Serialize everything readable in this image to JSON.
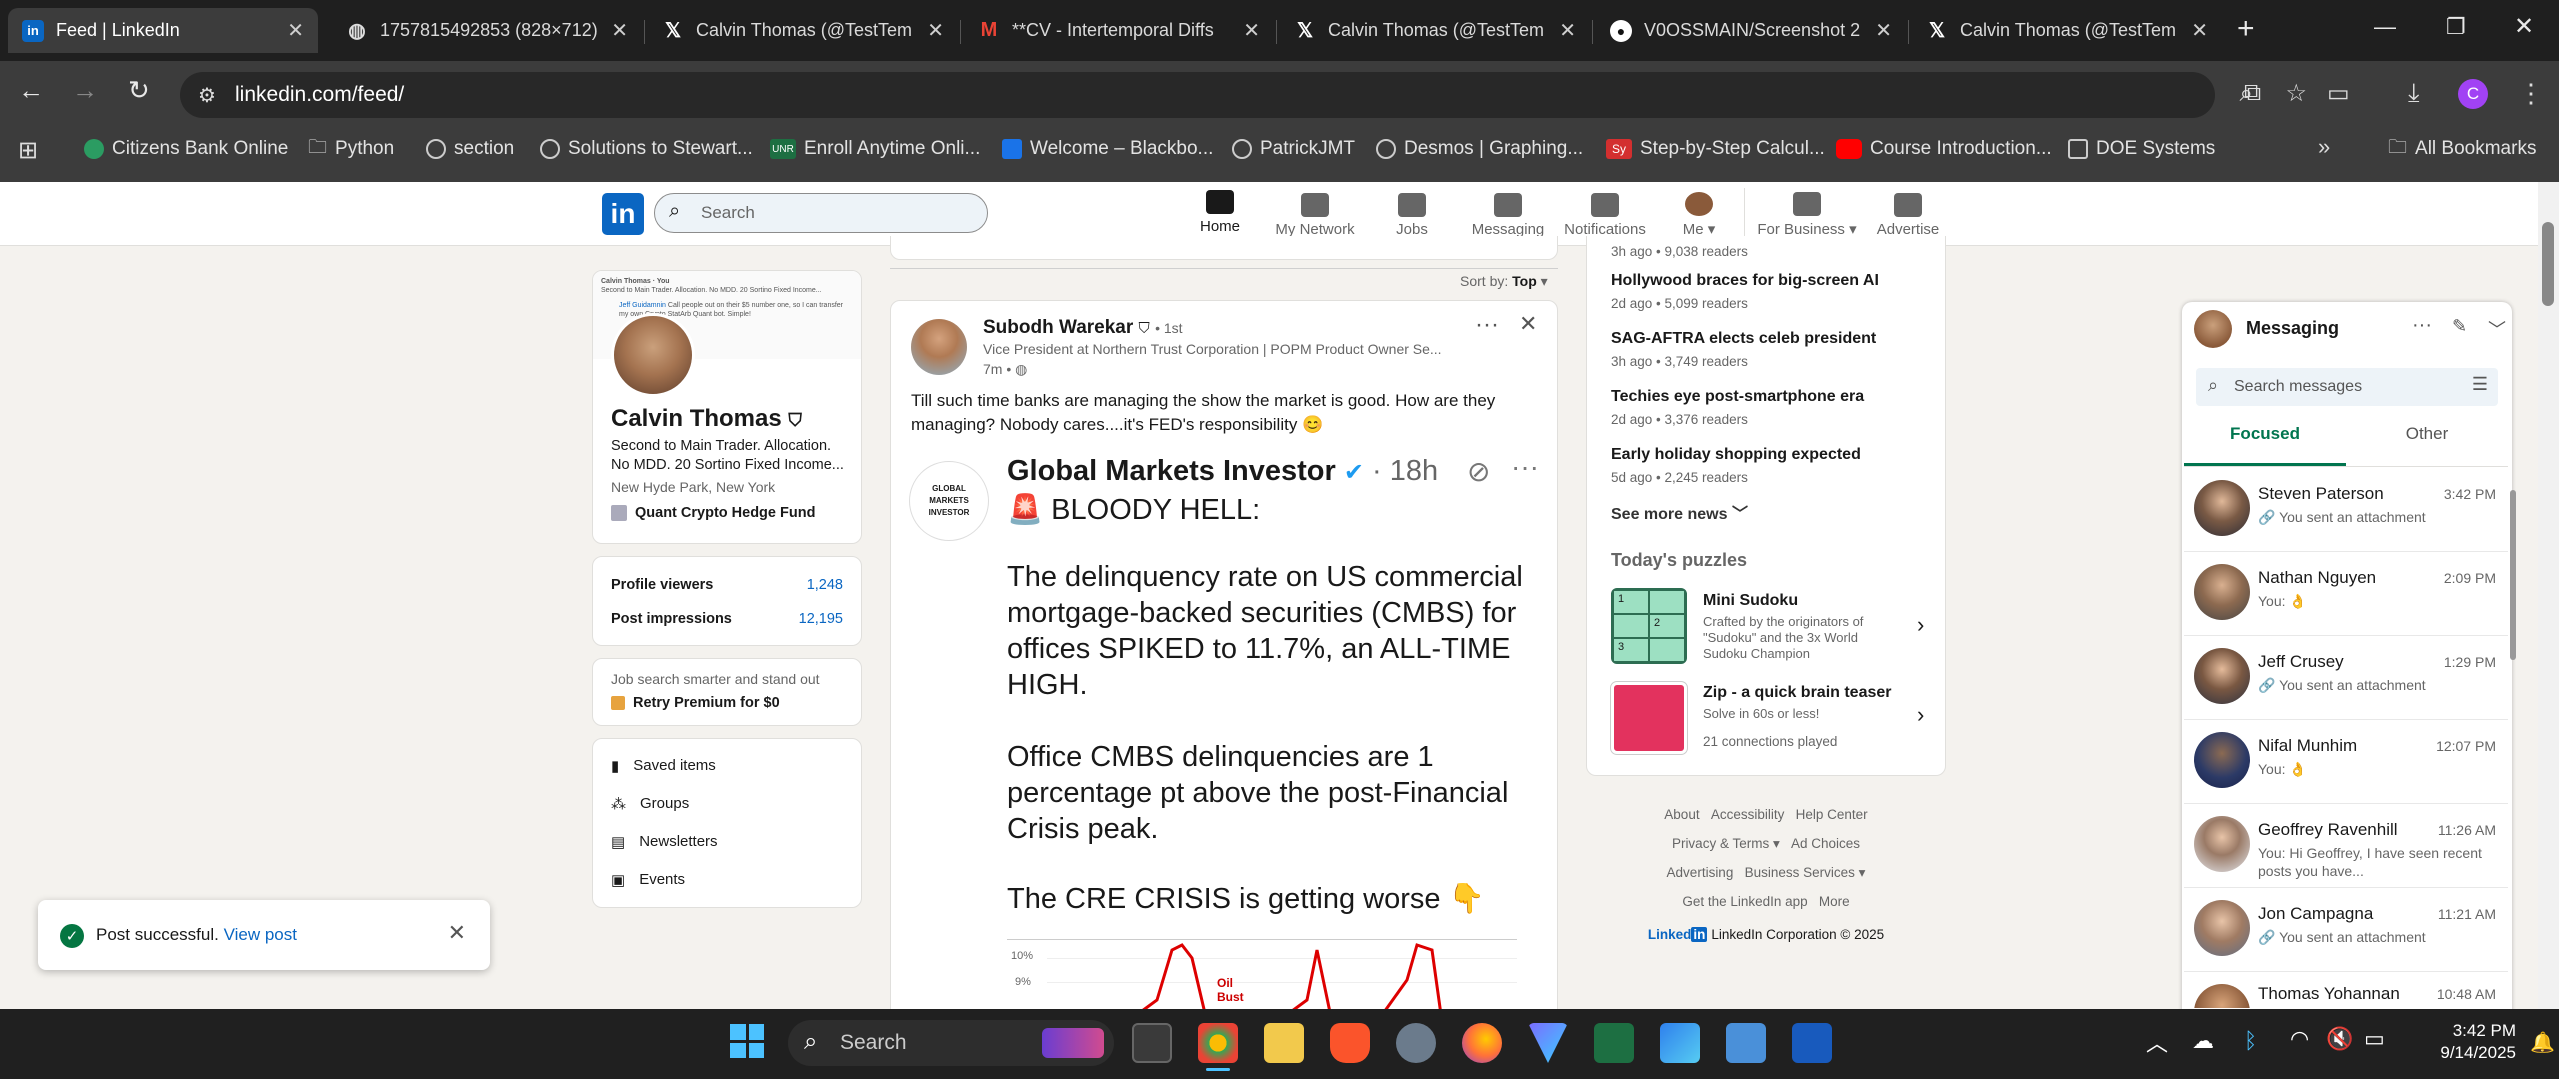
{
  "browser": {
    "tabs": [
      {
        "title": "Feed | LinkedIn",
        "icon": "linkedin-icon",
        "active": true
      },
      {
        "title": "1757815492853 (828×712)",
        "icon": "globe-icon"
      },
      {
        "title": "Calvin Thomas (@TestTem",
        "icon": "x-icon"
      },
      {
        "title": "**CV - Intertemporal Diffs",
        "icon": "gmail-icon"
      },
      {
        "title": "Calvin Thomas (@TestTem",
        "icon": "x-icon"
      },
      {
        "title": "V0OSSMAIN/Screenshot 2",
        "icon": "github-icon"
      },
      {
        "title": "Calvin Thomas (@TestTem",
        "icon": "x-icon"
      }
    ],
    "url": "linkedin.com/feed/",
    "profile_letter": "C",
    "bookmarks": [
      "Citizens Bank Online",
      "Python",
      "section",
      "Solutions to Stewart...",
      "Enroll Anytime Onli...",
      "Welcome – Blackbo...",
      "PatrickJMT",
      "Desmos | Graphing...",
      "Step-by-Step Calcul...",
      "Course Introduction...",
      "DOE Systems"
    ],
    "all_bookmarks": "All Bookmarks",
    "bookmark_badge_unr": "UNR",
    "bookmark_badge_sy": "Sy"
  },
  "linkedin": {
    "logo": "in",
    "search_placeholder": "Search",
    "nav": [
      {
        "label": "Home",
        "icon": "home-icon"
      },
      {
        "label": "My Network",
        "icon": "network-icon"
      },
      {
        "label": "Jobs",
        "icon": "briefcase-icon"
      },
      {
        "label": "Messaging",
        "icon": "chat-icon"
      },
      {
        "label": "Notifications",
        "icon": "bell-icon"
      },
      {
        "label": "Me",
        "icon": "avatar-icon"
      },
      {
        "label": "For Business",
        "icon": "grid-icon"
      },
      {
        "label": "Advertise",
        "icon": "compass-icon"
      }
    ],
    "profile": {
      "name": "Calvin Thomas",
      "headline": "Second to Main Trader. Allocation. No MDD. 20 Sortino Fixed Income...",
      "location": "New Hyde Park, New York",
      "company": "Quant Crypto Hedge Fund",
      "banner_line1": "Calvin Thomas · You",
      "banner_line2": "Second to Main Trader. Allocation. No MDD. 20 Sortino Fixed Income...",
      "banner_line3a": "Jeff Guidamnin",
      "banner_line3b": " Call people out on their $5 number one, so I can transfer my own Crypto StatArb Quant bot. Simple!",
      "stats": [
        {
          "label": "Profile viewers",
          "value": "1,248"
        },
        {
          "label": "Post impressions",
          "value": "12,195"
        }
      ],
      "premium_text": "Job search smarter and stand out",
      "premium_link": "Retry Premium for $0",
      "links": [
        "Saved items",
        "Groups",
        "Newsletters",
        "Events"
      ]
    },
    "toast": {
      "text": "Post successful.",
      "link": "View post"
    },
    "feed": {
      "sort_label": "Sort by:",
      "sort_value": "Top",
      "post": {
        "author": "Subodh Warekar",
        "degree": "• 1st",
        "title": "Vice President at Northern Trust Corporation | POPM Product Owner Se...",
        "time": "7m •",
        "text": "Till such time banks are managing the show the market is good. How are they managing? Nobody cares....it's FED's responsibility 😊",
        "embed": {
          "name": "Global Markets Investor",
          "time": "· 18h",
          "logo_text": "GLOBAL MARKETS INVESTOR",
          "headline": "🚨 BLOODY HELL:",
          "para1": "The delinquency rate on US commercial mortgage-backed securities (CMBS) for offices SPIKED to 11.7%, an ALL-TIME HIGH.",
          "para2": "Office CMBS delinquencies are 1 percentage pt above the post-Financial Crisis peak.",
          "para3": "The CRE CRISIS is getting worse 👇",
          "chart_ticks": [
            "10%",
            "9%"
          ],
          "chart_note": "Oil Bust"
        }
      }
    },
    "news": {
      "first_meta": "3h ago • 9,038 readers",
      "items": [
        {
          "title": "Hollywood braces for big-screen AI",
          "meta": "2d ago • 5,099 readers"
        },
        {
          "title": "SAG-AFTRA elects celeb president",
          "meta": "3h ago • 3,749 readers"
        },
        {
          "title": "Techies eye post-smartphone era",
          "meta": "2d ago • 3,376 readers"
        },
        {
          "title": "Early holiday shopping expected",
          "meta": "5d ago • 2,245 readers"
        }
      ],
      "see_more": "See more news",
      "puzzles_title": "Today's puzzles",
      "puzzles": [
        {
          "title": "Mini Sudoku",
          "desc": "Crafted by the originators of \"Sudoku\" and the 3x World Sudoku Champion",
          "cells": [
            "1",
            "2",
            "3"
          ]
        },
        {
          "title": "Zip - a quick brain teaser",
          "desc": "Solve in 60s or less!",
          "meta": "21 connections played"
        }
      ]
    },
    "footer": {
      "links": [
        "About",
        "Accessibility",
        "Help Center",
        "Privacy & Terms",
        "Ad Choices",
        "Advertising",
        "Business Services",
        "Get the LinkedIn app",
        "More"
      ],
      "brand": "Linked",
      "brand_in": "in",
      "copyright": "LinkedIn Corporation © 2025"
    },
    "messaging": {
      "title": "Messaging",
      "search_placeholder": "Search messages",
      "tabs": [
        "Focused",
        "Other"
      ],
      "threads": [
        {
          "name": "Steven Paterson",
          "time": "3:42 PM",
          "preview": "🔗 You sent an attachment"
        },
        {
          "name": "Nathan Nguyen",
          "time": "2:09 PM",
          "preview": "You: 👌"
        },
        {
          "name": "Jeff Crusey",
          "time": "1:29 PM",
          "preview": "🔗 You sent an attachment"
        },
        {
          "name": "Nifal Munhim",
          "time": "12:07 PM",
          "preview": "You: 👌"
        },
        {
          "name": "Geoffrey Ravenhill",
          "time": "11:26 AM",
          "preview": "You: Hi Geoffrey, I have seen recent posts you have..."
        },
        {
          "name": "Jon Campagna",
          "time": "11:21 AM",
          "preview": "🔗 You sent an attachment"
        },
        {
          "name": "Thomas Yohannan",
          "time": "10:48 AM",
          "preview": ""
        }
      ]
    }
  },
  "taskbar": {
    "search": "Search",
    "time": "3:42 PM",
    "date": "9/14/2025"
  }
}
